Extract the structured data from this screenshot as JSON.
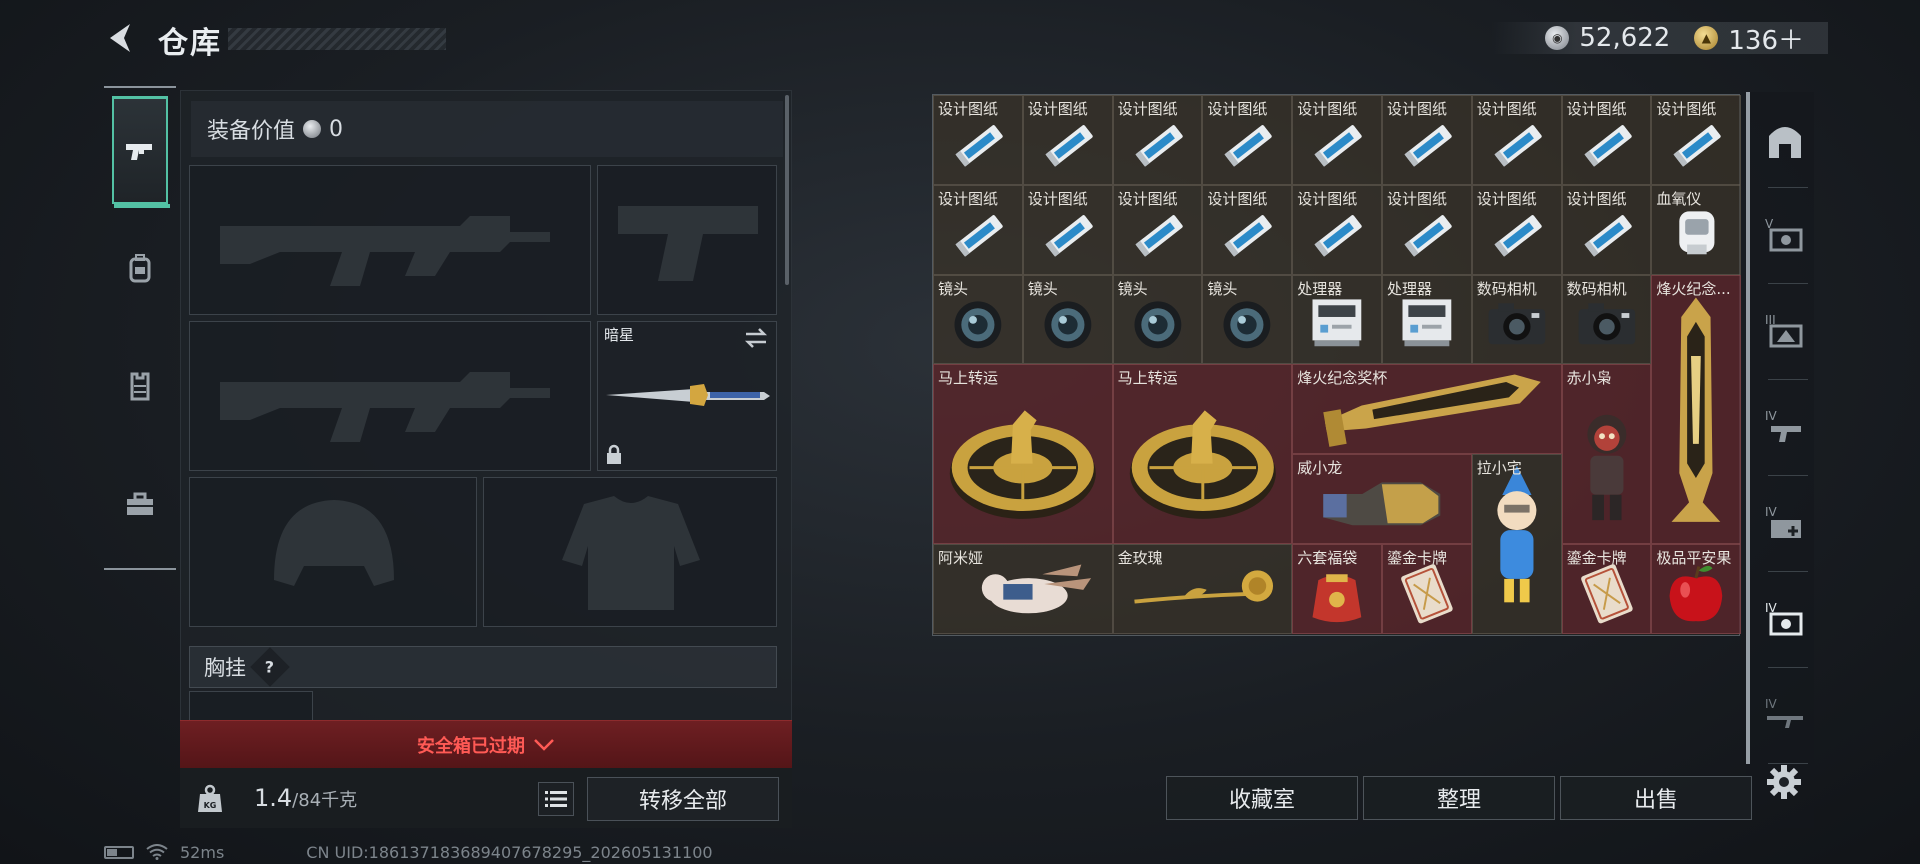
{
  "header": {
    "title": "仓库",
    "currencies": [
      {
        "icon": "silver-coin-icon",
        "value": "52,622"
      },
      {
        "icon": "gold-coin-icon",
        "value": "136＋"
      }
    ]
  },
  "left_tabs": [
    {
      "icon": "pistol-icon",
      "active": true
    },
    {
      "icon": "backpack-icon",
      "active": false
    },
    {
      "icon": "vest-icon",
      "active": false
    },
    {
      "icon": "toolbox-icon",
      "active": false
    }
  ],
  "equipment": {
    "value_label": "装备价值",
    "value": "0",
    "melee_slot_label": "暗星",
    "chest_rig_label": "胸挂",
    "help": "?"
  },
  "safe_box": {
    "label": "安全箱已过期"
  },
  "weight": {
    "current": "1.4",
    "max_unit": "/84千克"
  },
  "buttons": {
    "transfer_all": "转移全部",
    "collection": "收藏室",
    "organize": "整理",
    "sell": "出售"
  },
  "status_bar": {
    "ping": "52ms",
    "uid": "CN UID:186137183689407678295_202605131100"
  },
  "inventory": {
    "items": [
      {
        "label": "设计图纸",
        "art": "blueprint"
      },
      {
        "label": "设计图纸",
        "art": "blueprint"
      },
      {
        "label": "设计图纸",
        "art": "blueprint"
      },
      {
        "label": "设计图纸",
        "art": "blueprint"
      },
      {
        "label": "设计图纸",
        "art": "blueprint"
      },
      {
        "label": "设计图纸",
        "art": "blueprint"
      },
      {
        "label": "设计图纸",
        "art": "blueprint"
      },
      {
        "label": "设计图纸",
        "art": "blueprint"
      },
      {
        "label": "设计图纸",
        "art": "blueprint"
      },
      {
        "label": "设计图纸",
        "art": "blueprint"
      },
      {
        "label": "设计图纸",
        "art": "blueprint"
      },
      {
        "label": "设计图纸",
        "art": "blueprint"
      },
      {
        "label": "设计图纸",
        "art": "blueprint"
      },
      {
        "label": "设计图纸",
        "art": "blueprint"
      },
      {
        "label": "设计图纸",
        "art": "blueprint"
      },
      {
        "label": "设计图纸",
        "art": "blueprint"
      },
      {
        "label": "设计图纸",
        "art": "blueprint"
      },
      {
        "label": "血氧仪",
        "art": "oximeter"
      },
      {
        "label": "镜头",
        "art": "lens"
      },
      {
        "label": "镜头",
        "art": "lens"
      },
      {
        "label": "镜头",
        "art": "lens"
      },
      {
        "label": "镜头",
        "art": "lens"
      },
      {
        "label": "处理器",
        "art": "processor"
      },
      {
        "label": "处理器",
        "art": "processor"
      },
      {
        "label": "数码相机",
        "art": "camera"
      },
      {
        "label": "数码相机",
        "art": "camera"
      },
      {
        "label": "烽火纪念...",
        "art": "trophy"
      },
      {
        "label": "马上转运",
        "art": "horse-coin"
      },
      {
        "label": "马上转运",
        "art": "horse-coin"
      },
      {
        "label": "烽火纪念奖杯",
        "art": "trophy-h"
      },
      {
        "label": "赤小枭",
        "art": "figure-red"
      },
      {
        "label": "威小龙",
        "art": "gauntlet"
      },
      {
        "label": "拉小宅",
        "art": "figure-blue"
      },
      {
        "label": "阿米娅",
        "art": "bunny"
      },
      {
        "label": "金玫瑰",
        "art": "rose"
      },
      {
        "label": "六套福袋",
        "art": "luckybag"
      },
      {
        "label": "鎏金卡牌",
        "art": "card"
      },
      {
        "label": "鎏金卡牌",
        "art": "card"
      },
      {
        "label": "极品平安果",
        "art": "apple"
      }
    ]
  },
  "right_tabs": [
    "safe-icon",
    "tier-v-camera-icon",
    "tier-iii-gear-icon",
    "tier-iv-gun-icon",
    "tier-iv-medkit-icon",
    "tier-iv-camera-icon",
    "tier-iv-rifle-icon"
  ],
  "colors": {
    "accent": "#53c1a4",
    "alert": "#ff5a55",
    "rare_cell": "#60262c"
  }
}
